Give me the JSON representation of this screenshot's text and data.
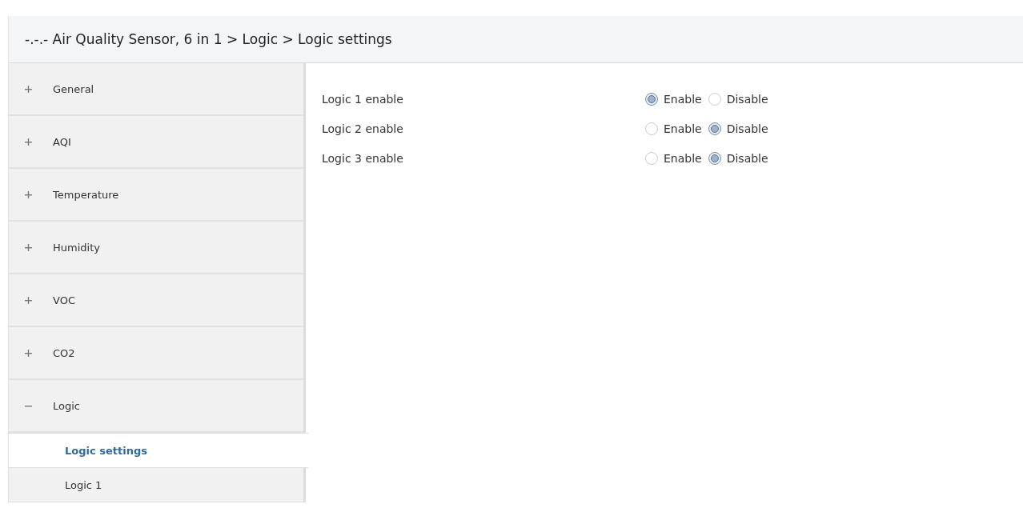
{
  "header": {
    "title": "-.-.- Air Quality Sensor, 6 in 1 > Logic > Logic settings"
  },
  "sidebar": {
    "items": [
      {
        "label": "General",
        "expanded": false
      },
      {
        "label": "AQI",
        "expanded": false
      },
      {
        "label": "Temperature",
        "expanded": false
      },
      {
        "label": "Humidity",
        "expanded": false
      },
      {
        "label": "VOC",
        "expanded": false
      },
      {
        "label": "CO2",
        "expanded": false
      },
      {
        "label": "Logic",
        "expanded": true,
        "children": [
          {
            "label": "Logic settings",
            "selected": true
          },
          {
            "label": "Logic 1",
            "selected": false
          }
        ]
      }
    ]
  },
  "settings": [
    {
      "label": "Logic 1 enable",
      "options": [
        {
          "label": "Enable",
          "selected": true
        },
        {
          "label": "Disable",
          "selected": false
        }
      ]
    },
    {
      "label": "Logic 2 enable",
      "options": [
        {
          "label": "Enable",
          "selected": false
        },
        {
          "label": "Disable",
          "selected": true
        }
      ]
    },
    {
      "label": "Logic 3 enable",
      "options": [
        {
          "label": "Enable",
          "selected": false
        },
        {
          "label": "Disable",
          "selected": true
        }
      ]
    }
  ]
}
